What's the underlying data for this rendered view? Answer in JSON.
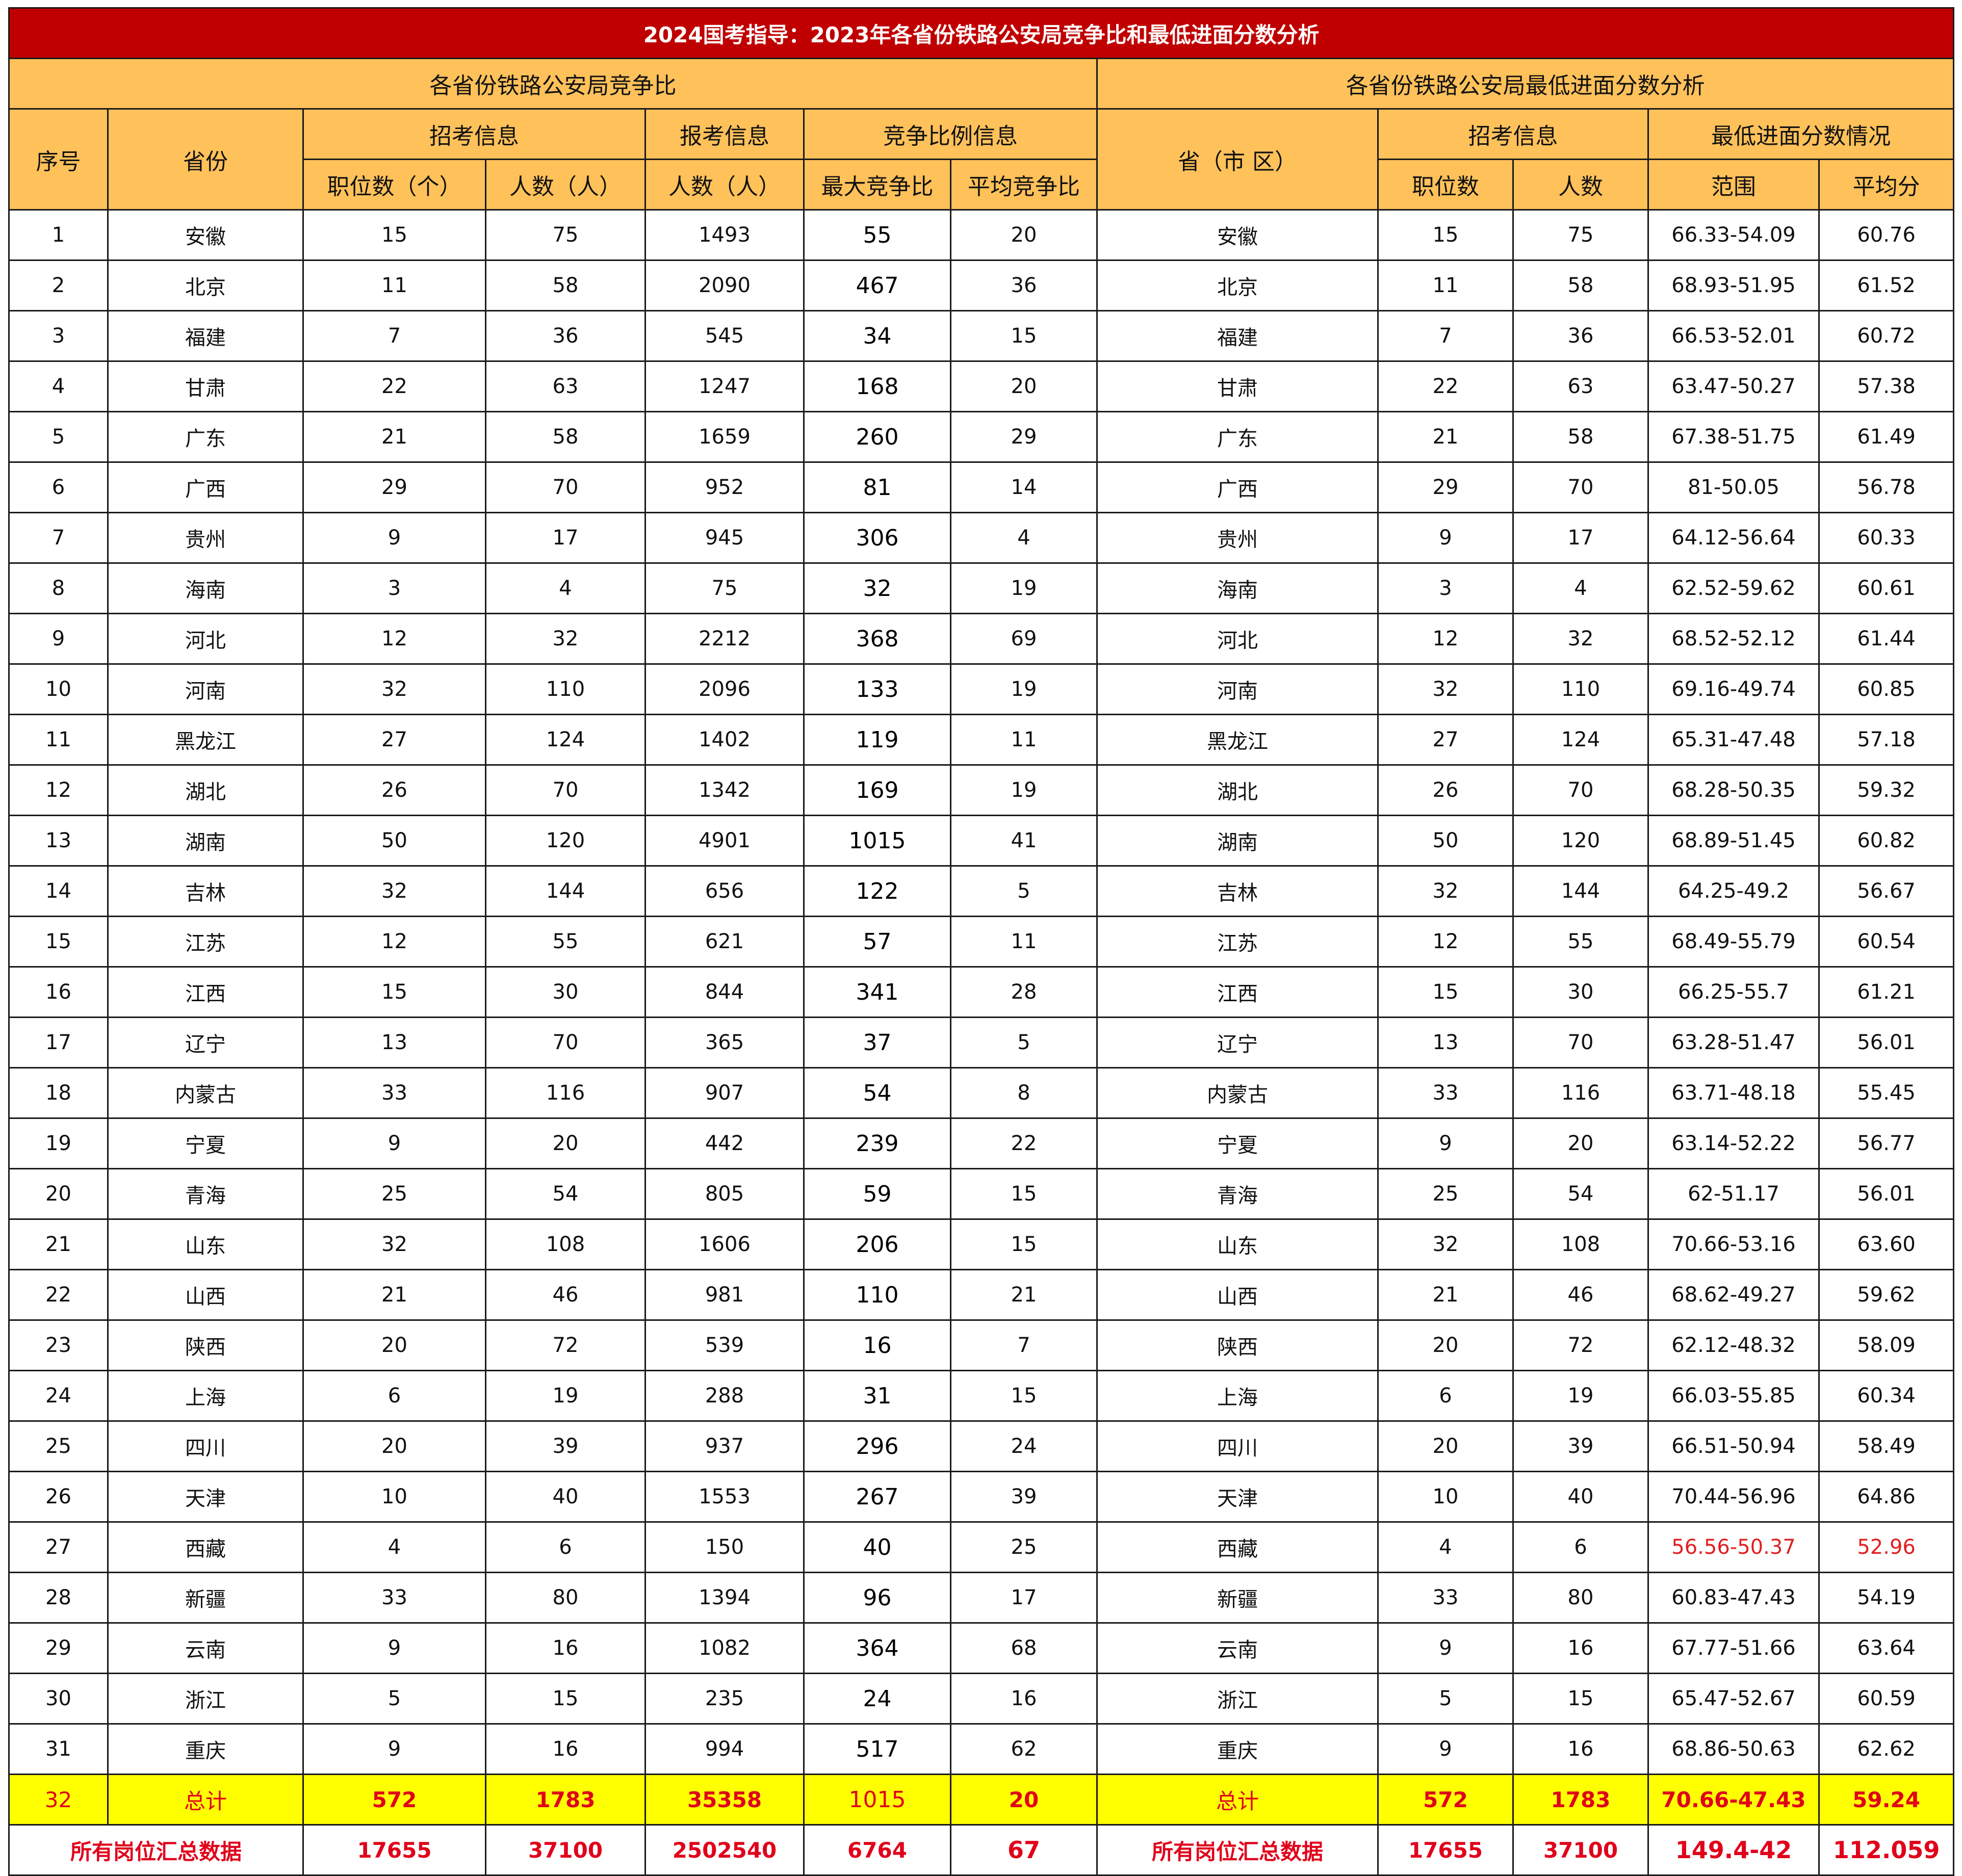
{
  "title": "2024国考指导：2023年各省份铁路公安局竞争比和最低进面分数分析",
  "left_section": "各省份铁路公安局竞争比",
  "right_section": "各省份铁路公安局最低进面分数分析",
  "headers": {
    "seq": "序号",
    "province": "省份",
    "recruit_info": "招考信息",
    "apply_info": "报考信息",
    "ratio_info": "竞争比例信息",
    "positions": "职位数（个）",
    "people": "人数（人）",
    "applicants": "人数（人）",
    "max_ratio": "最大竞争比",
    "avg_ratio": "平均竞争比",
    "province_r": "省（市 区）",
    "recruit_info_r": "招考信息",
    "score_info": "最低进面分数情况",
    "positions_r": "职位数",
    "people_r": "人数",
    "range": "范围",
    "avg_score": "平均分"
  },
  "rows": [
    [
      "1",
      "安徽",
      "15",
      "75",
      "1493",
      "55",
      "20",
      "安徽",
      "15",
      "75",
      "66.33-54.09",
      "60.76"
    ],
    [
      "2",
      "北京",
      "11",
      "58",
      "2090",
      "467",
      "36",
      "北京",
      "11",
      "58",
      "68.93-51.95",
      "61.52"
    ],
    [
      "3",
      "福建",
      "7",
      "36",
      "545",
      "34",
      "15",
      "福建",
      "7",
      "36",
      "66.53-52.01",
      "60.72"
    ],
    [
      "4",
      "甘肃",
      "22",
      "63",
      "1247",
      "168",
      "20",
      "甘肃",
      "22",
      "63",
      "63.47-50.27",
      "57.38"
    ],
    [
      "5",
      "广东",
      "21",
      "58",
      "1659",
      "260",
      "29",
      "广东",
      "21",
      "58",
      "67.38-51.75",
      "61.49"
    ],
    [
      "6",
      "广西",
      "29",
      "70",
      "952",
      "81",
      "14",
      "广西",
      "29",
      "70",
      "81-50.05",
      "56.78"
    ],
    [
      "7",
      "贵州",
      "9",
      "17",
      "945",
      "306",
      "4",
      "贵州",
      "9",
      "17",
      "64.12-56.64",
      "60.33"
    ],
    [
      "8",
      "海南",
      "3",
      "4",
      "75",
      "32",
      "19",
      "海南",
      "3",
      "4",
      "62.52-59.62",
      "60.61"
    ],
    [
      "9",
      "河北",
      "12",
      "32",
      "2212",
      "368",
      "69",
      "河北",
      "12",
      "32",
      "68.52-52.12",
      "61.44"
    ],
    [
      "10",
      "河南",
      "32",
      "110",
      "2096",
      "133",
      "19",
      "河南",
      "32",
      "110",
      "69.16-49.74",
      "60.85"
    ],
    [
      "11",
      "黑龙江",
      "27",
      "124",
      "1402",
      "119",
      "11",
      "黑龙江",
      "27",
      "124",
      "65.31-47.48",
      "57.18"
    ],
    [
      "12",
      "湖北",
      "26",
      "70",
      "1342",
      "169",
      "19",
      "湖北",
      "26",
      "70",
      "68.28-50.35",
      "59.32"
    ],
    [
      "13",
      "湖南",
      "50",
      "120",
      "4901",
      "1015",
      "41",
      "湖南",
      "50",
      "120",
      "68.89-51.45",
      "60.82"
    ],
    [
      "14",
      "吉林",
      "32",
      "144",
      "656",
      "122",
      "5",
      "吉林",
      "32",
      "144",
      "64.25-49.2",
      "56.67"
    ],
    [
      "15",
      "江苏",
      "12",
      "55",
      "621",
      "57",
      "11",
      "江苏",
      "12",
      "55",
      "68.49-55.79",
      "60.54"
    ],
    [
      "16",
      "江西",
      "15",
      "30",
      "844",
      "341",
      "28",
      "江西",
      "15",
      "30",
      "66.25-55.7",
      "61.21"
    ],
    [
      "17",
      "辽宁",
      "13",
      "70",
      "365",
      "37",
      "5",
      "辽宁",
      "13",
      "70",
      "63.28-51.47",
      "56.01"
    ],
    [
      "18",
      "内蒙古",
      "33",
      "116",
      "907",
      "54",
      "8",
      "内蒙古",
      "33",
      "116",
      "63.71-48.18",
      "55.45"
    ],
    [
      "19",
      "宁夏",
      "9",
      "20",
      "442",
      "239",
      "22",
      "宁夏",
      "9",
      "20",
      "63.14-52.22",
      "56.77"
    ],
    [
      "20",
      "青海",
      "25",
      "54",
      "805",
      "59",
      "15",
      "青海",
      "25",
      "54",
      "62-51.17",
      "56.01"
    ],
    [
      "21",
      "山东",
      "32",
      "108",
      "1606",
      "206",
      "15",
      "山东",
      "32",
      "108",
      "70.66-53.16",
      "63.60"
    ],
    [
      "22",
      "山西",
      "21",
      "46",
      "981",
      "110",
      "21",
      "山西",
      "21",
      "46",
      "68.62-49.27",
      "59.62"
    ],
    [
      "23",
      "陕西",
      "20",
      "72",
      "539",
      "16",
      "7",
      "陕西",
      "20",
      "72",
      "62.12-48.32",
      "58.09"
    ],
    [
      "24",
      "上海",
      "6",
      "19",
      "288",
      "31",
      "15",
      "上海",
      "6",
      "19",
      "66.03-55.85",
      "60.34"
    ],
    [
      "25",
      "四川",
      "20",
      "39",
      "937",
      "296",
      "24",
      "四川",
      "20",
      "39",
      "66.51-50.94",
      "58.49"
    ],
    [
      "26",
      "天津",
      "10",
      "40",
      "1553",
      "267",
      "39",
      "天津",
      "10",
      "40",
      "70.44-56.96",
      "64.86"
    ],
    [
      "27",
      "西藏",
      "4",
      "6",
      "150",
      "40",
      "25",
      "西藏",
      "4",
      "6",
      "56.56-50.37",
      "52.96"
    ],
    [
      "28",
      "新疆",
      "33",
      "80",
      "1394",
      "96",
      "17",
      "新疆",
      "33",
      "80",
      "60.83-47.43",
      "54.19"
    ],
    [
      "29",
      "云南",
      "9",
      "16",
      "1082",
      "364",
      "68",
      "云南",
      "9",
      "16",
      "67.77-51.66",
      "63.64"
    ],
    [
      "30",
      "浙江",
      "5",
      "15",
      "235",
      "24",
      "16",
      "浙江",
      "5",
      "15",
      "65.47-52.67",
      "60.59"
    ],
    [
      "31",
      "重庆",
      "9",
      "16",
      "994",
      "517",
      "62",
      "重庆",
      "9",
      "16",
      "68.86-50.63",
      "62.62"
    ]
  ],
  "highlight_row_index": 26,
  "highlight_color": "#e02020",
  "total": [
    "32",
    "总计",
    "572",
    "1783",
    "35358",
    "1015",
    "20",
    "总计",
    "572",
    "1783",
    "70.66-47.43",
    "59.24"
  ],
  "all": {
    "label_left": "所有岗位汇总数据",
    "positions": "17655",
    "people": "37100",
    "applicants": "2502540",
    "max_ratio": "6764",
    "avg_ratio": "67",
    "label_right": "所有岗位汇总数据",
    "positions_r": "17655",
    "people_r": "37100",
    "range": "149.4-42",
    "avg_score": "112.059"
  },
  "colors": {
    "title_bg": "#c00000",
    "header_bg": "#ffc15a",
    "total_bg": "#ffff00",
    "total_text": "#e0001a"
  }
}
